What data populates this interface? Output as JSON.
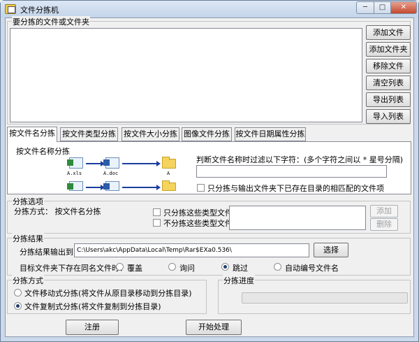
{
  "window": {
    "title": "文件分拣机",
    "min": "─",
    "max": "□",
    "close": "✕"
  },
  "files_group": {
    "label": "要分拣的文件或文件夹",
    "buttons": [
      "添加文件",
      "添加文件夹",
      "移除文件(夹)",
      "清空列表",
      "导出列表",
      "导入列表"
    ]
  },
  "tabs": [
    "按文件名分拣",
    "按文件类型分拣",
    "按文件大小分拣",
    "图像文件分拣",
    "按文件日期属性分拣"
  ],
  "tab_panel": {
    "group_label": "按文件名称分拣",
    "diagram": {
      "file1": "A.xls",
      "file2": "A.doc",
      "folder1": "A"
    },
    "filter_label": "判断文件名称时过滤以下字符：(多个字符之间以 * 星号分隔)",
    "filter_value": "",
    "only_existing_label": "只分拣与输出文件夹下已存在目录的相匹配的文件项"
  },
  "options": {
    "label": "分拣选项",
    "method_text": "分拣方式：  按文件名分拣",
    "only_types_label": "只分拣这些类型文件：",
    "exclude_types_label": "不分拣这些类型文件：",
    "add_btn": "添加",
    "delete_btn": "删除"
  },
  "result": {
    "label": "分拣结果",
    "output_label": "分拣结果输出到：",
    "output_path": "C:\\Users\\akc\\AppData\\Local\\Temp\\Rar$EXa0.536\\",
    "choose_btn": "选择",
    "conflict_label": "目标文件夹下存在同名文件时：",
    "conflict_options": [
      "覆盖",
      "询问",
      "跳过",
      "自动编号文件名"
    ],
    "conflict_selected": "跳过"
  },
  "mode": {
    "label": "分拣方式",
    "options": [
      "文件移动式分拣(将文件从原目录移动到分拣目录)",
      "文件复制式分拣(将文件复制到分拣目录)"
    ],
    "selected": "文件复制式分拣(将文件复制到分拣目录)"
  },
  "progress": {
    "label": "分拣进度",
    "value": 0
  },
  "footer": {
    "register_btn": "注册",
    "start_btn": "开始处理"
  }
}
